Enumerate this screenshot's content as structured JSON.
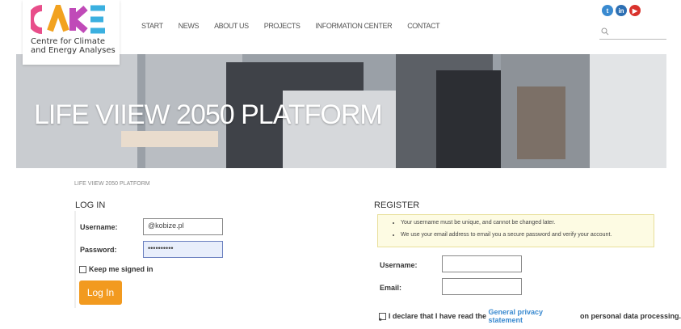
{
  "brand": {
    "logo_letters": "CAKE",
    "name_line1": "Centre for Climate",
    "name_line2": "and Energy Analyses"
  },
  "nav": [
    "START",
    "NEWS",
    "ABOUT US",
    "PROJECTS",
    "INFORMATION CENTER",
    "CONTACT"
  ],
  "social": [
    {
      "icon": "twitter-icon",
      "color": "#3a8ad0",
      "glyph": "t"
    },
    {
      "icon": "linkedin-icon",
      "color": "#2d6fb3",
      "glyph": "in"
    },
    {
      "icon": "youtube-icon",
      "color": "#d9322c",
      "glyph": "▶"
    }
  ],
  "hero": {
    "title": "LIFE VIIEW 2050 PLATFORM"
  },
  "breadcrumb": "LIFE VIIEW 2050 PLATFORM",
  "login": {
    "heading": "LOG IN",
    "username_label": "Username:",
    "username_value": "@kobize.pl",
    "password_label": "Password:",
    "password_value": "••••••••••",
    "keep_signed_in": "Keep me signed in",
    "button": "Log In"
  },
  "register": {
    "heading": "REGISTER",
    "notices": [
      "Your username must be unique, and cannot be changed later.",
      "We use your email address to email you a secure password and verify your account."
    ],
    "username_label": "Username:",
    "email_label": "Email:",
    "declare_prefix": "I declare that I have read the ",
    "declare_link": "General privacy statement",
    "declare_suffix": " on personal data processing.",
    "required_mark": "*"
  }
}
